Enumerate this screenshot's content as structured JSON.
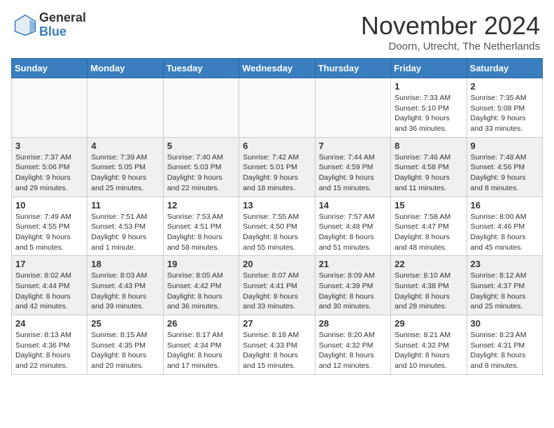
{
  "header": {
    "logo_general": "General",
    "logo_blue": "Blue",
    "month_title": "November 2024",
    "subtitle": "Doorn, Utrecht, The Netherlands"
  },
  "days_of_week": [
    "Sunday",
    "Monday",
    "Tuesday",
    "Wednesday",
    "Thursday",
    "Friday",
    "Saturday"
  ],
  "weeks": [
    [
      {
        "day": "",
        "info": ""
      },
      {
        "day": "",
        "info": ""
      },
      {
        "day": "",
        "info": ""
      },
      {
        "day": "",
        "info": ""
      },
      {
        "day": "",
        "info": ""
      },
      {
        "day": "1",
        "info": "Sunrise: 7:33 AM\nSunset: 5:10 PM\nDaylight: 9 hours and 36 minutes."
      },
      {
        "day": "2",
        "info": "Sunrise: 7:35 AM\nSunset: 5:08 PM\nDaylight: 9 hours and 33 minutes."
      }
    ],
    [
      {
        "day": "3",
        "info": "Sunrise: 7:37 AM\nSunset: 5:06 PM\nDaylight: 9 hours and 29 minutes."
      },
      {
        "day": "4",
        "info": "Sunrise: 7:39 AM\nSunset: 5:05 PM\nDaylight: 9 hours and 25 minutes."
      },
      {
        "day": "5",
        "info": "Sunrise: 7:40 AM\nSunset: 5:03 PM\nDaylight: 9 hours and 22 minutes."
      },
      {
        "day": "6",
        "info": "Sunrise: 7:42 AM\nSunset: 5:01 PM\nDaylight: 9 hours and 18 minutes."
      },
      {
        "day": "7",
        "info": "Sunrise: 7:44 AM\nSunset: 4:59 PM\nDaylight: 9 hours and 15 minutes."
      },
      {
        "day": "8",
        "info": "Sunrise: 7:46 AM\nSunset: 4:58 PM\nDaylight: 9 hours and 11 minutes."
      },
      {
        "day": "9",
        "info": "Sunrise: 7:48 AM\nSunset: 4:56 PM\nDaylight: 9 hours and 8 minutes."
      }
    ],
    [
      {
        "day": "10",
        "info": "Sunrise: 7:49 AM\nSunset: 4:55 PM\nDaylight: 9 hours and 5 minutes."
      },
      {
        "day": "11",
        "info": "Sunrise: 7:51 AM\nSunset: 4:53 PM\nDaylight: 9 hours and 1 minute."
      },
      {
        "day": "12",
        "info": "Sunrise: 7:53 AM\nSunset: 4:51 PM\nDaylight: 8 hours and 58 minutes."
      },
      {
        "day": "13",
        "info": "Sunrise: 7:55 AM\nSunset: 4:50 PM\nDaylight: 8 hours and 55 minutes."
      },
      {
        "day": "14",
        "info": "Sunrise: 7:57 AM\nSunset: 4:48 PM\nDaylight: 8 hours and 51 minutes."
      },
      {
        "day": "15",
        "info": "Sunrise: 7:58 AM\nSunset: 4:47 PM\nDaylight: 8 hours and 48 minutes."
      },
      {
        "day": "16",
        "info": "Sunrise: 8:00 AM\nSunset: 4:46 PM\nDaylight: 8 hours and 45 minutes."
      }
    ],
    [
      {
        "day": "17",
        "info": "Sunrise: 8:02 AM\nSunset: 4:44 PM\nDaylight: 8 hours and 42 minutes."
      },
      {
        "day": "18",
        "info": "Sunrise: 8:03 AM\nSunset: 4:43 PM\nDaylight: 8 hours and 39 minutes."
      },
      {
        "day": "19",
        "info": "Sunrise: 8:05 AM\nSunset: 4:42 PM\nDaylight: 8 hours and 36 minutes."
      },
      {
        "day": "20",
        "info": "Sunrise: 8:07 AM\nSunset: 4:41 PM\nDaylight: 8 hours and 33 minutes."
      },
      {
        "day": "21",
        "info": "Sunrise: 8:09 AM\nSunset: 4:39 PM\nDaylight: 8 hours and 30 minutes."
      },
      {
        "day": "22",
        "info": "Sunrise: 8:10 AM\nSunset: 4:38 PM\nDaylight: 8 hours and 28 minutes."
      },
      {
        "day": "23",
        "info": "Sunrise: 8:12 AM\nSunset: 4:37 PM\nDaylight: 8 hours and 25 minutes."
      }
    ],
    [
      {
        "day": "24",
        "info": "Sunrise: 8:13 AM\nSunset: 4:36 PM\nDaylight: 8 hours and 22 minutes."
      },
      {
        "day": "25",
        "info": "Sunrise: 8:15 AM\nSunset: 4:35 PM\nDaylight: 8 hours and 20 minutes."
      },
      {
        "day": "26",
        "info": "Sunrise: 8:17 AM\nSunset: 4:34 PM\nDaylight: 8 hours and 17 minutes."
      },
      {
        "day": "27",
        "info": "Sunrise: 8:18 AM\nSunset: 4:33 PM\nDaylight: 8 hours and 15 minutes."
      },
      {
        "day": "28",
        "info": "Sunrise: 8:20 AM\nSunset: 4:32 PM\nDaylight: 8 hours and 12 minutes."
      },
      {
        "day": "29",
        "info": "Sunrise: 8:21 AM\nSunset: 4:32 PM\nDaylight: 8 hours and 10 minutes."
      },
      {
        "day": "30",
        "info": "Sunrise: 8:23 AM\nSunset: 4:31 PM\nDaylight: 8 hours and 8 minutes."
      }
    ]
  ]
}
